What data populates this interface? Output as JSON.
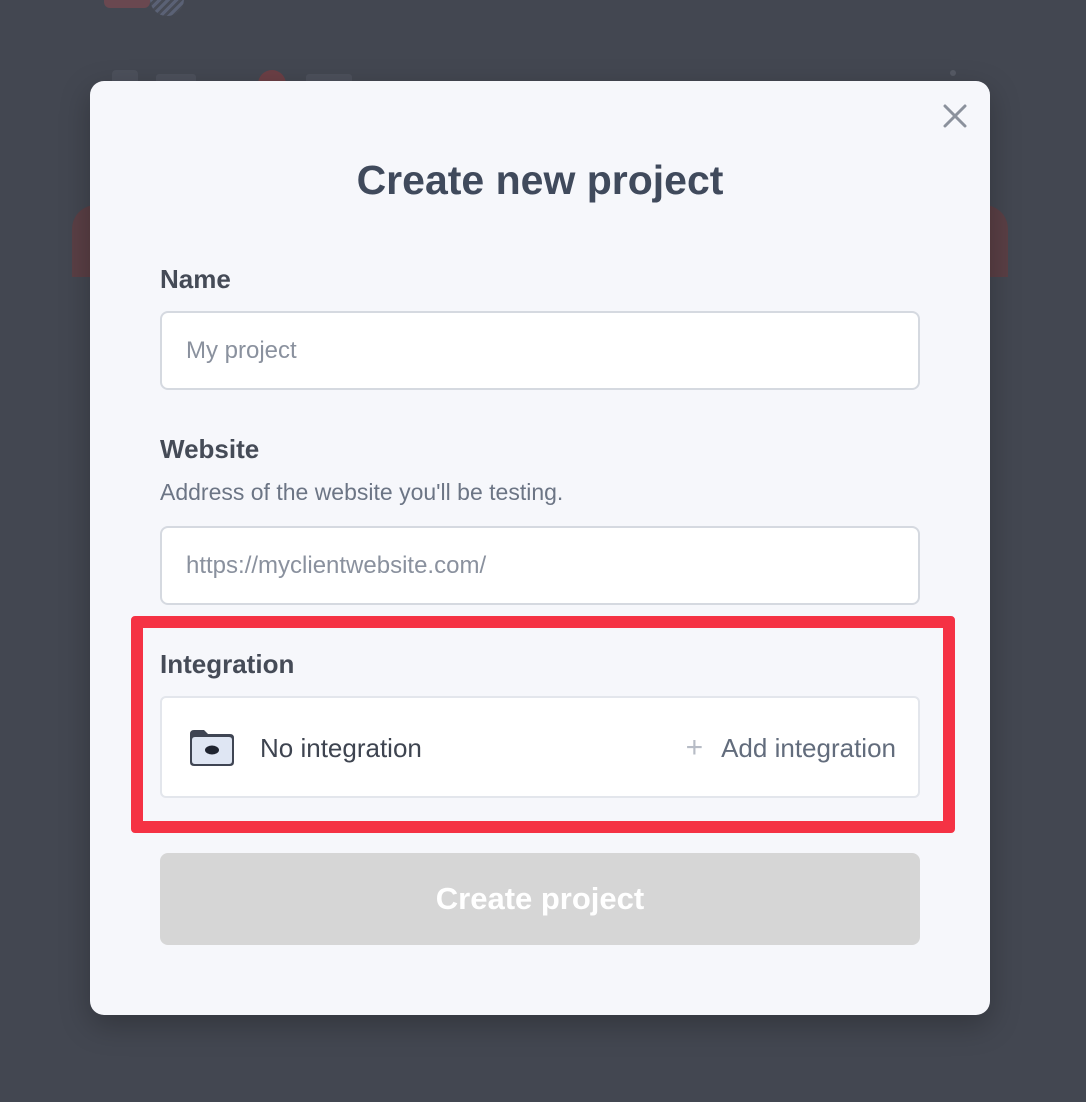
{
  "modal": {
    "title": "Create new project",
    "close_icon": "close-icon"
  },
  "name_field": {
    "label": "Name",
    "value": "",
    "placeholder": "My project"
  },
  "website_field": {
    "label": "Website",
    "hint": "Address of the website you'll be testing.",
    "value": "",
    "placeholder": "https://myclientwebsite.com/"
  },
  "integration": {
    "label": "Integration",
    "current": "No integration",
    "icon": "folder-icon",
    "add_icon": "plus-icon",
    "add_label": "Add integration"
  },
  "actions": {
    "create_label": "Create project",
    "create_enabled": false
  },
  "colors": {
    "overlay": "#434751",
    "modal_bg": "#f6f7fb",
    "title": "#404a5c",
    "highlight": "#f53244",
    "button_disabled": "#d6d6d6"
  }
}
